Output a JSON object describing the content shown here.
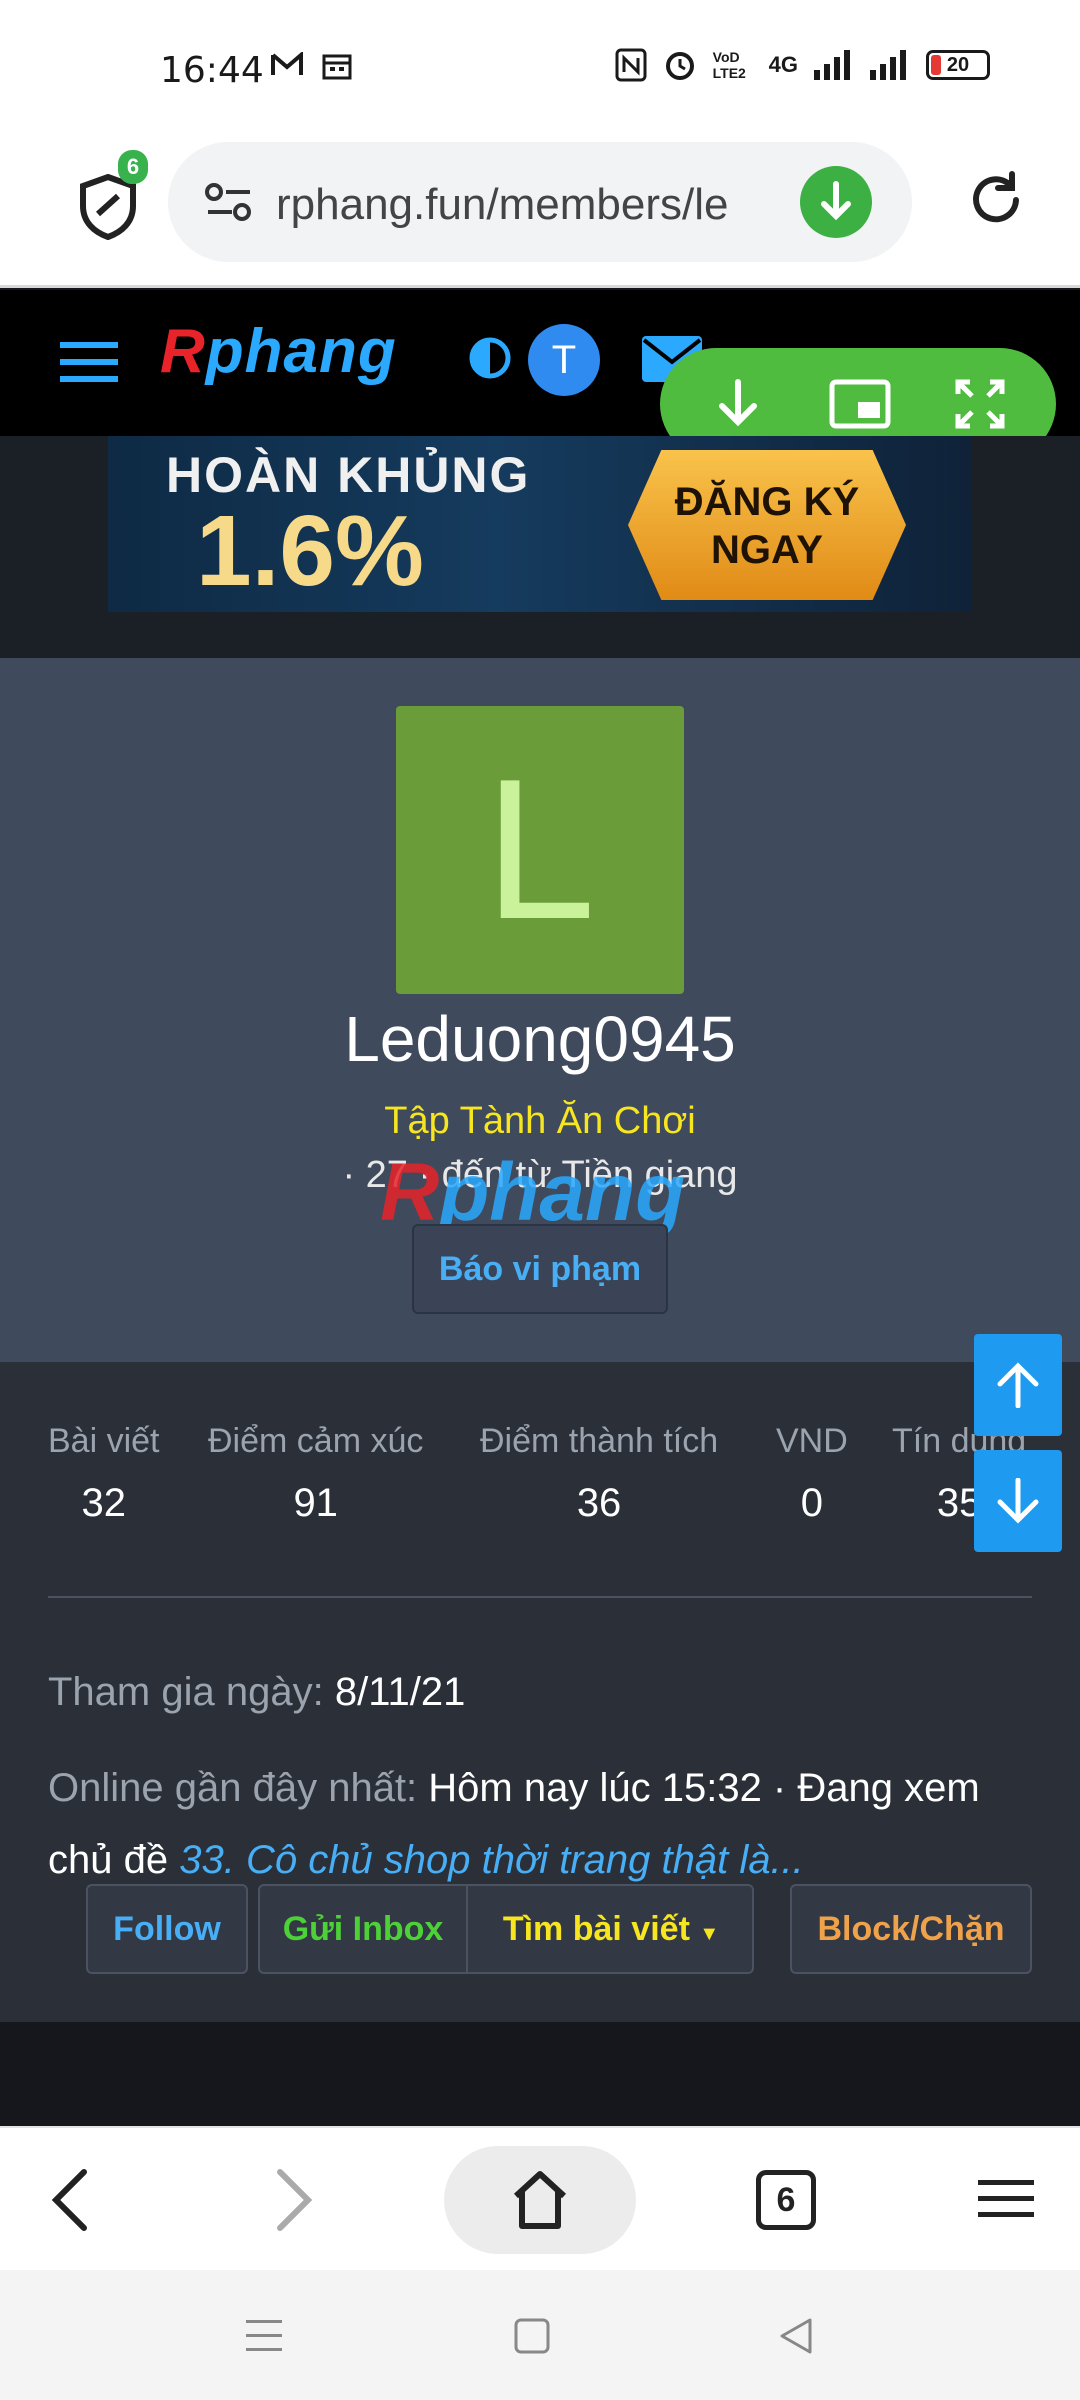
{
  "status_bar": {
    "time": "16:44",
    "right_labels": [
      "VoD LTE2",
      "4G"
    ],
    "battery": "20"
  },
  "browser": {
    "shield_badge": "6",
    "url": "rphang.fun/members/le",
    "tabs_count": "6"
  },
  "site": {
    "logo_r": "R",
    "logo_rest": "phang",
    "avatar_letter": "T"
  },
  "banner": {
    "line1": "HOÀN KHỦNG",
    "line2": "1.6%",
    "cta_line1": "ĐĂNG KÝ",
    "cta_line2": "NGAY"
  },
  "profile": {
    "avatar_letter": "L",
    "username": "Leduong0945",
    "user_title": "Tập Tành Ăn Chơi",
    "info": "· 27 · đến từ Tiền giang",
    "report_label": "Báo vi phạm"
  },
  "stats": [
    {
      "label": "Bài viết",
      "value": "32"
    },
    {
      "label": "Điểm cảm xúc",
      "value": "91"
    },
    {
      "label": "Điểm thành tích",
      "value": "36"
    },
    {
      "label": "VND",
      "value": "0"
    },
    {
      "label": "Tín dụng",
      "value": "35"
    }
  ],
  "details": {
    "joined_label": "Tham gia ngày:",
    "joined_value": "8/11/21",
    "online_label": "Online gần đây nhất:",
    "online_value": "Hôm nay lúc 15:32 · Đang xem chủ đề",
    "online_thread": "33. Cô chủ shop thời trang thật là..."
  },
  "actions": {
    "follow": "Follow",
    "inbox": "Gửi Inbox",
    "find_posts": "Tìm bài viết",
    "block": "Block/Chặn"
  },
  "colors": {
    "accent_blue": "#48aef5",
    "title_yellow": "#f6e51f",
    "avatar_green": "#6a9c3a",
    "pip_green": "#4fbb3f",
    "block_orange": "#f0a24a",
    "inbox_green": "#4cd137"
  }
}
